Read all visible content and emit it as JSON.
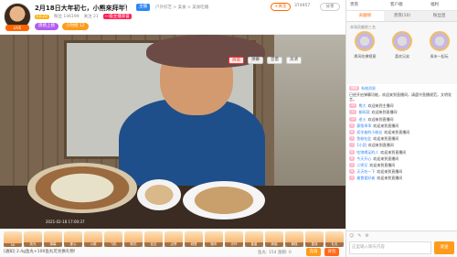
{
  "header": {
    "title": "2月18日大年初七，小熊来拜年！",
    "host_badge": "主播",
    "fans_label": "粉丝团",
    "breadcrumb": "户外综艺 > 美食 > 美食吃播",
    "follow_label": "+关注",
    "hot_count": "374957",
    "share_label": "分享",
    "avatar_tag": "LIVE",
    "meta": [
      "Lv.22",
      "粉丝 146199",
      "关注 21",
      "一级主播荣誉"
    ],
    "badges": [
      "周榜上榜",
      "小时榜 12"
    ]
  },
  "video": {
    "controls": [
      "画面",
      "弹幕",
      "音量",
      "高清"
    ],
    "timestamp": "2021-02-18 17:00:37"
  },
  "giftbar": {
    "gifts": [
      "SK",
      "荧光",
      "弹幕",
      "爱心",
      "火箭",
      "飞机",
      "鲜花",
      "钻石",
      "点赞",
      "城堡",
      "跑车",
      "光环",
      "星星",
      "熊猫",
      "蛋糕",
      "皇冠",
      "礼包"
    ],
    "notice": "[通知] 2.4g鱼丸+100鱼丸可兑换礼物!",
    "stat": "鱼丸: 154   翅膀: 0",
    "charge_label": "充值",
    "bag_label": "背包"
  },
  "panel": {
    "top": [
      "贵宾",
      "客户端",
      "福利"
    ],
    "tabs": [
      "贡献榜",
      "贵宾(10)",
      "粉丝团"
    ],
    "rank_line": "本场贡献前三名",
    "ranks": [
      "厚风吹拂惬意",
      "喜欢兄弟",
      "周末一起玩"
    ],
    "chat": [
      {
        "badge": "熊团",
        "user": "系统消息",
        "text": "已经开启弹幕功能，欢迎来到直播间，请遵守直播规范，文明发言。"
      },
      {
        "badge": "15",
        "user": "熊大",
        "text": "欢迎来到主播间"
      },
      {
        "badge": "12",
        "user": "御风观",
        "text": "欢迎来到直播间"
      },
      {
        "badge": "10",
        "user": "老火",
        "text": "欢迎来到直播间"
      },
      {
        "badge": "9",
        "user": "赛兔乖乖",
        "text": "欢迎来到直播间"
      },
      {
        "badge": "8",
        "user": "初学者的小粉丝",
        "text": "欢迎来到直播间"
      },
      {
        "badge": "7",
        "user": "鱼粉在此",
        "text": "欢迎来到直播间"
      },
      {
        "badge": "7",
        "user": "1小团",
        "text": "欢迎来到直播间"
      },
      {
        "badge": "6",
        "user": "吃饱喝足的人",
        "text": "欢迎来到直播间"
      },
      {
        "badge": "6",
        "user": "今天开心",
        "text": "欢迎来到直播间"
      },
      {
        "badge": "5",
        "user": "二师兄",
        "text": "欢迎来到直播间"
      },
      {
        "badge": "5",
        "user": "天天吃一下",
        "text": "欢迎来到直播间"
      },
      {
        "badge": "4",
        "user": "美食爱好者",
        "text": "欢迎来到直播间"
      }
    ],
    "input_placeholder": "这里输入聊天内容",
    "send_label": "发送"
  },
  "colors": {
    "accent": "#ff9b1a",
    "blue": "#2f86f6",
    "pink": "#ffb8c9"
  }
}
